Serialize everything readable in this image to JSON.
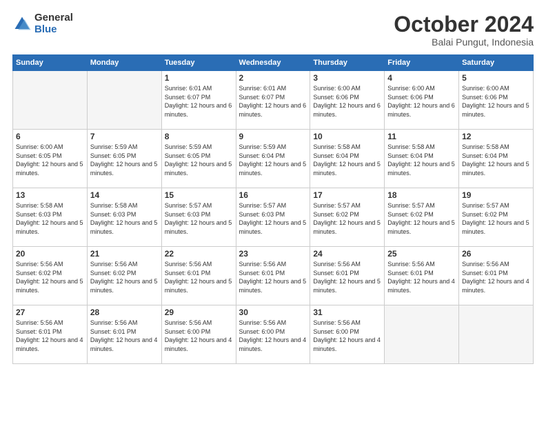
{
  "logo": {
    "general": "General",
    "blue": "Blue"
  },
  "title": "October 2024",
  "location": "Balai Pungut, Indonesia",
  "weekdays": [
    "Sunday",
    "Monday",
    "Tuesday",
    "Wednesday",
    "Thursday",
    "Friday",
    "Saturday"
  ],
  "weeks": [
    [
      {
        "day": null
      },
      {
        "day": null
      },
      {
        "day": 1,
        "sunrise": "6:01 AM",
        "sunset": "6:07 PM",
        "daylight": "12 hours and 6 minutes."
      },
      {
        "day": 2,
        "sunrise": "6:01 AM",
        "sunset": "6:07 PM",
        "daylight": "12 hours and 6 minutes."
      },
      {
        "day": 3,
        "sunrise": "6:00 AM",
        "sunset": "6:06 PM",
        "daylight": "12 hours and 6 minutes."
      },
      {
        "day": 4,
        "sunrise": "6:00 AM",
        "sunset": "6:06 PM",
        "daylight": "12 hours and 6 minutes."
      },
      {
        "day": 5,
        "sunrise": "6:00 AM",
        "sunset": "6:06 PM",
        "daylight": "12 hours and 5 minutes."
      }
    ],
    [
      {
        "day": 6,
        "sunrise": "6:00 AM",
        "sunset": "6:05 PM",
        "daylight": "12 hours and 5 minutes."
      },
      {
        "day": 7,
        "sunrise": "5:59 AM",
        "sunset": "6:05 PM",
        "daylight": "12 hours and 5 minutes."
      },
      {
        "day": 8,
        "sunrise": "5:59 AM",
        "sunset": "6:05 PM",
        "daylight": "12 hours and 5 minutes."
      },
      {
        "day": 9,
        "sunrise": "5:59 AM",
        "sunset": "6:04 PM",
        "daylight": "12 hours and 5 minutes."
      },
      {
        "day": 10,
        "sunrise": "5:58 AM",
        "sunset": "6:04 PM",
        "daylight": "12 hours and 5 minutes."
      },
      {
        "day": 11,
        "sunrise": "5:58 AM",
        "sunset": "6:04 PM",
        "daylight": "12 hours and 5 minutes."
      },
      {
        "day": 12,
        "sunrise": "5:58 AM",
        "sunset": "6:04 PM",
        "daylight": "12 hours and 5 minutes."
      }
    ],
    [
      {
        "day": 13,
        "sunrise": "5:58 AM",
        "sunset": "6:03 PM",
        "daylight": "12 hours and 5 minutes."
      },
      {
        "day": 14,
        "sunrise": "5:58 AM",
        "sunset": "6:03 PM",
        "daylight": "12 hours and 5 minutes."
      },
      {
        "day": 15,
        "sunrise": "5:57 AM",
        "sunset": "6:03 PM",
        "daylight": "12 hours and 5 minutes."
      },
      {
        "day": 16,
        "sunrise": "5:57 AM",
        "sunset": "6:03 PM",
        "daylight": "12 hours and 5 minutes."
      },
      {
        "day": 17,
        "sunrise": "5:57 AM",
        "sunset": "6:02 PM",
        "daylight": "12 hours and 5 minutes."
      },
      {
        "day": 18,
        "sunrise": "5:57 AM",
        "sunset": "6:02 PM",
        "daylight": "12 hours and 5 minutes."
      },
      {
        "day": 19,
        "sunrise": "5:57 AM",
        "sunset": "6:02 PM",
        "daylight": "12 hours and 5 minutes."
      }
    ],
    [
      {
        "day": 20,
        "sunrise": "5:56 AM",
        "sunset": "6:02 PM",
        "daylight": "12 hours and 5 minutes."
      },
      {
        "day": 21,
        "sunrise": "5:56 AM",
        "sunset": "6:02 PM",
        "daylight": "12 hours and 5 minutes."
      },
      {
        "day": 22,
        "sunrise": "5:56 AM",
        "sunset": "6:01 PM",
        "daylight": "12 hours and 5 minutes."
      },
      {
        "day": 23,
        "sunrise": "5:56 AM",
        "sunset": "6:01 PM",
        "daylight": "12 hours and 5 minutes."
      },
      {
        "day": 24,
        "sunrise": "5:56 AM",
        "sunset": "6:01 PM",
        "daylight": "12 hours and 5 minutes."
      },
      {
        "day": 25,
        "sunrise": "5:56 AM",
        "sunset": "6:01 PM",
        "daylight": "12 hours and 4 minutes."
      },
      {
        "day": 26,
        "sunrise": "5:56 AM",
        "sunset": "6:01 PM",
        "daylight": "12 hours and 4 minutes."
      }
    ],
    [
      {
        "day": 27,
        "sunrise": "5:56 AM",
        "sunset": "6:01 PM",
        "daylight": "12 hours and 4 minutes."
      },
      {
        "day": 28,
        "sunrise": "5:56 AM",
        "sunset": "6:01 PM",
        "daylight": "12 hours and 4 minutes."
      },
      {
        "day": 29,
        "sunrise": "5:56 AM",
        "sunset": "6:00 PM",
        "daylight": "12 hours and 4 minutes."
      },
      {
        "day": 30,
        "sunrise": "5:56 AM",
        "sunset": "6:00 PM",
        "daylight": "12 hours and 4 minutes."
      },
      {
        "day": 31,
        "sunrise": "5:56 AM",
        "sunset": "6:00 PM",
        "daylight": "12 hours and 4 minutes."
      },
      {
        "day": null
      },
      {
        "day": null
      }
    ]
  ]
}
